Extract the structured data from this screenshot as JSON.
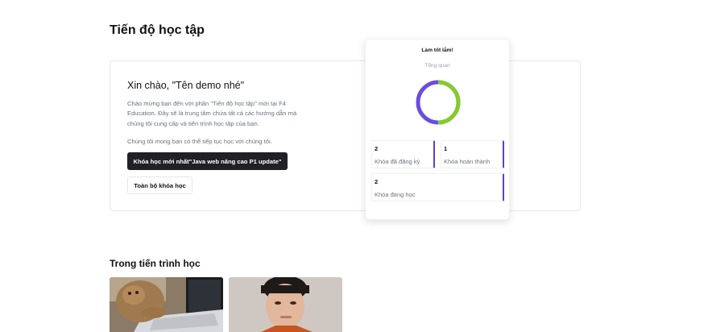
{
  "page": {
    "title": "Tiến độ học tập"
  },
  "welcome": {
    "title": "Xin chào, \"Tên demo nhé\"",
    "description": "Chào mừng bạn đến với phần \"Tiến độ học tập\" mới tại F4 Education. Đây sẽ là trung tâm chứa tất cả các hướng dẫn mà chúng tôi cung cấp và tiến trình học tập của bạn.",
    "note": "Chúng tôi mong bạn có thể tiếp tục học với chúng tôi.",
    "latest_course_button": "Khóa học mới nhất\"Java web nâng cao P1 update\"",
    "all_courses_button": "Toàn bộ khóa học"
  },
  "overview": {
    "heading": "Làm tốt lắm!",
    "subheading": "Tổng quan",
    "chart": {
      "completed_fraction": 0.5,
      "color_completed": "#84cc2c",
      "color_remaining": "#6a4de0"
    },
    "stats": {
      "registered": {
        "value": "2",
        "label": "Khóa đã đăng ký"
      },
      "completed": {
        "value": "1",
        "label": "Khóa hoàn thành"
      },
      "in_progress": {
        "value": "2",
        "label": "Khóa đang học"
      }
    },
    "accent_color": "#5b3fd6"
  },
  "in_progress_section": {
    "title": "Trong tiến trình học",
    "courses": [
      {
        "thumbnail_icon": "cat-laptop-photo"
      },
      {
        "thumbnail_icon": "person-portrait-photo"
      }
    ]
  }
}
